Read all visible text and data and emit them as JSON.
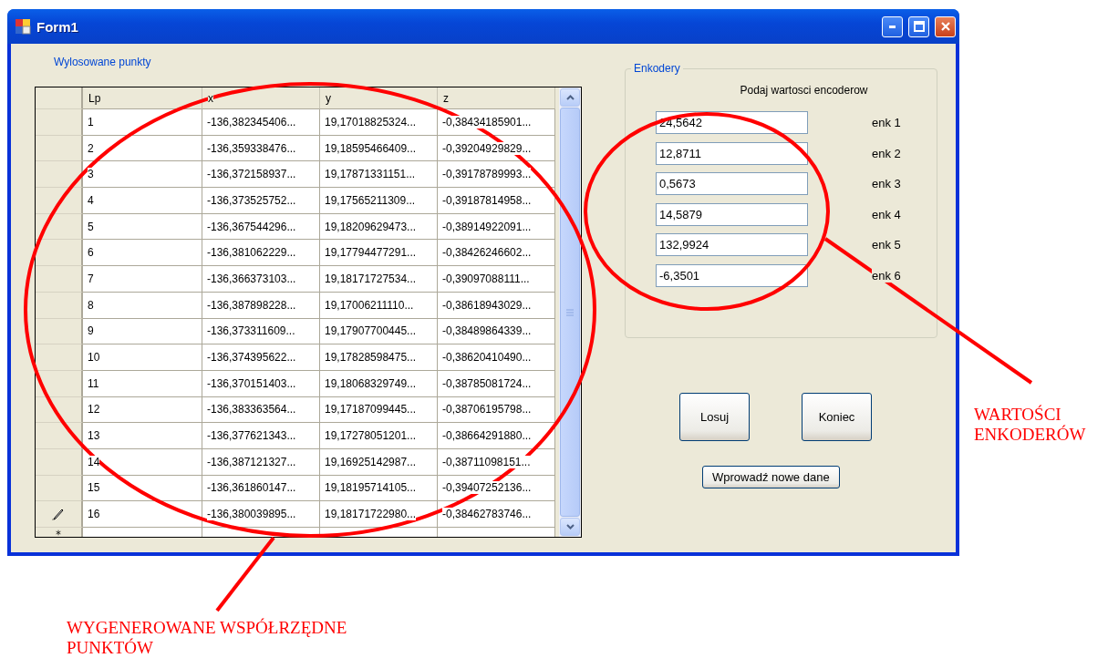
{
  "window": {
    "title": "Form1"
  },
  "points": {
    "label": "Wylosowane punkty",
    "columns": [
      "Lp",
      "x",
      "y",
      "z"
    ],
    "new_row": true,
    "rows": [
      {
        "cells": [
          "1",
          "-136,382345406...",
          "19,17018825324...",
          "-0,38434185901..."
        ],
        "editing": false
      },
      {
        "cells": [
          "2",
          "-136,359338476...",
          "19,18595466409...",
          "-0,39204929829..."
        ],
        "editing": false
      },
      {
        "cells": [
          "3",
          "-136,372158937...",
          "19,17871331151...",
          "-0,39178789993..."
        ],
        "editing": false
      },
      {
        "cells": [
          "4",
          "-136,373525752...",
          "19,17565211309...",
          "-0,39187814958..."
        ],
        "editing": false
      },
      {
        "cells": [
          "5",
          "-136,367544296...",
          "19,18209629473...",
          "-0,38914922091..."
        ],
        "editing": false
      },
      {
        "cells": [
          "6",
          "-136,381062229...",
          "19,17794477291...",
          "-0,38426246602..."
        ],
        "editing": false
      },
      {
        "cells": [
          "7",
          "-136,366373103...",
          "19,18171727534...",
          "-0,39097088111..."
        ],
        "editing": false
      },
      {
        "cells": [
          "8",
          "-136,387898228...",
          "19,17006211110...",
          "-0,38618943029..."
        ],
        "editing": false
      },
      {
        "cells": [
          "9",
          "-136,373311609...",
          "19,17907700445...",
          "-0,38489864339..."
        ],
        "editing": false
      },
      {
        "cells": [
          "10",
          "-136,374395622...",
          "19,17828598475...",
          "-0,38620410490..."
        ],
        "editing": false
      },
      {
        "cells": [
          "11",
          "-136,370151403...",
          "19,18068329749...",
          "-0,38785081724..."
        ],
        "editing": false
      },
      {
        "cells": [
          "12",
          "-136,383363564...",
          "19,17187099445...",
          "-0,38706195798..."
        ],
        "editing": false
      },
      {
        "cells": [
          "13",
          "-136,377621343...",
          "19,17278051201...",
          "-0,38664291880..."
        ],
        "editing": false
      },
      {
        "cells": [
          "14",
          "-136,387121327...",
          "19,16925142987...",
          "-0,38711098151..."
        ],
        "editing": false
      },
      {
        "cells": [
          "15",
          "-136,361860147...",
          "19,18195714105...",
          "-0,39407252136..."
        ],
        "editing": false
      },
      {
        "cells": [
          "16",
          "-136,380039895...",
          "19,18171722980...",
          "-0,38462783746..."
        ],
        "editing": true
      }
    ]
  },
  "encoders": {
    "title": "Enkodery",
    "prompt": "Podaj wartosci encoderow",
    "fields": [
      {
        "value": "24,5642",
        "label": "enk 1"
      },
      {
        "value": "12,8711",
        "label": "enk 2"
      },
      {
        "value": "0,5673",
        "label": "enk 3"
      },
      {
        "value": "14,5879",
        "label": "enk 4"
      },
      {
        "value": "132,9924",
        "label": "enk 5"
      },
      {
        "value": "-6,3501",
        "label": "enk 6"
      }
    ]
  },
  "buttons": [
    "Losuj",
    "Koniec"
  ],
  "secondary_button": "Wprowadź nowe dane",
  "annotations": [
    {
      "text": "WARTOŚCI ENKODERÓW",
      "kind": "encoders"
    },
    {
      "text": "WYGENEROWANE WSPÓŁRZĘDNE PUNKTÓW",
      "kind": "points"
    }
  ]
}
